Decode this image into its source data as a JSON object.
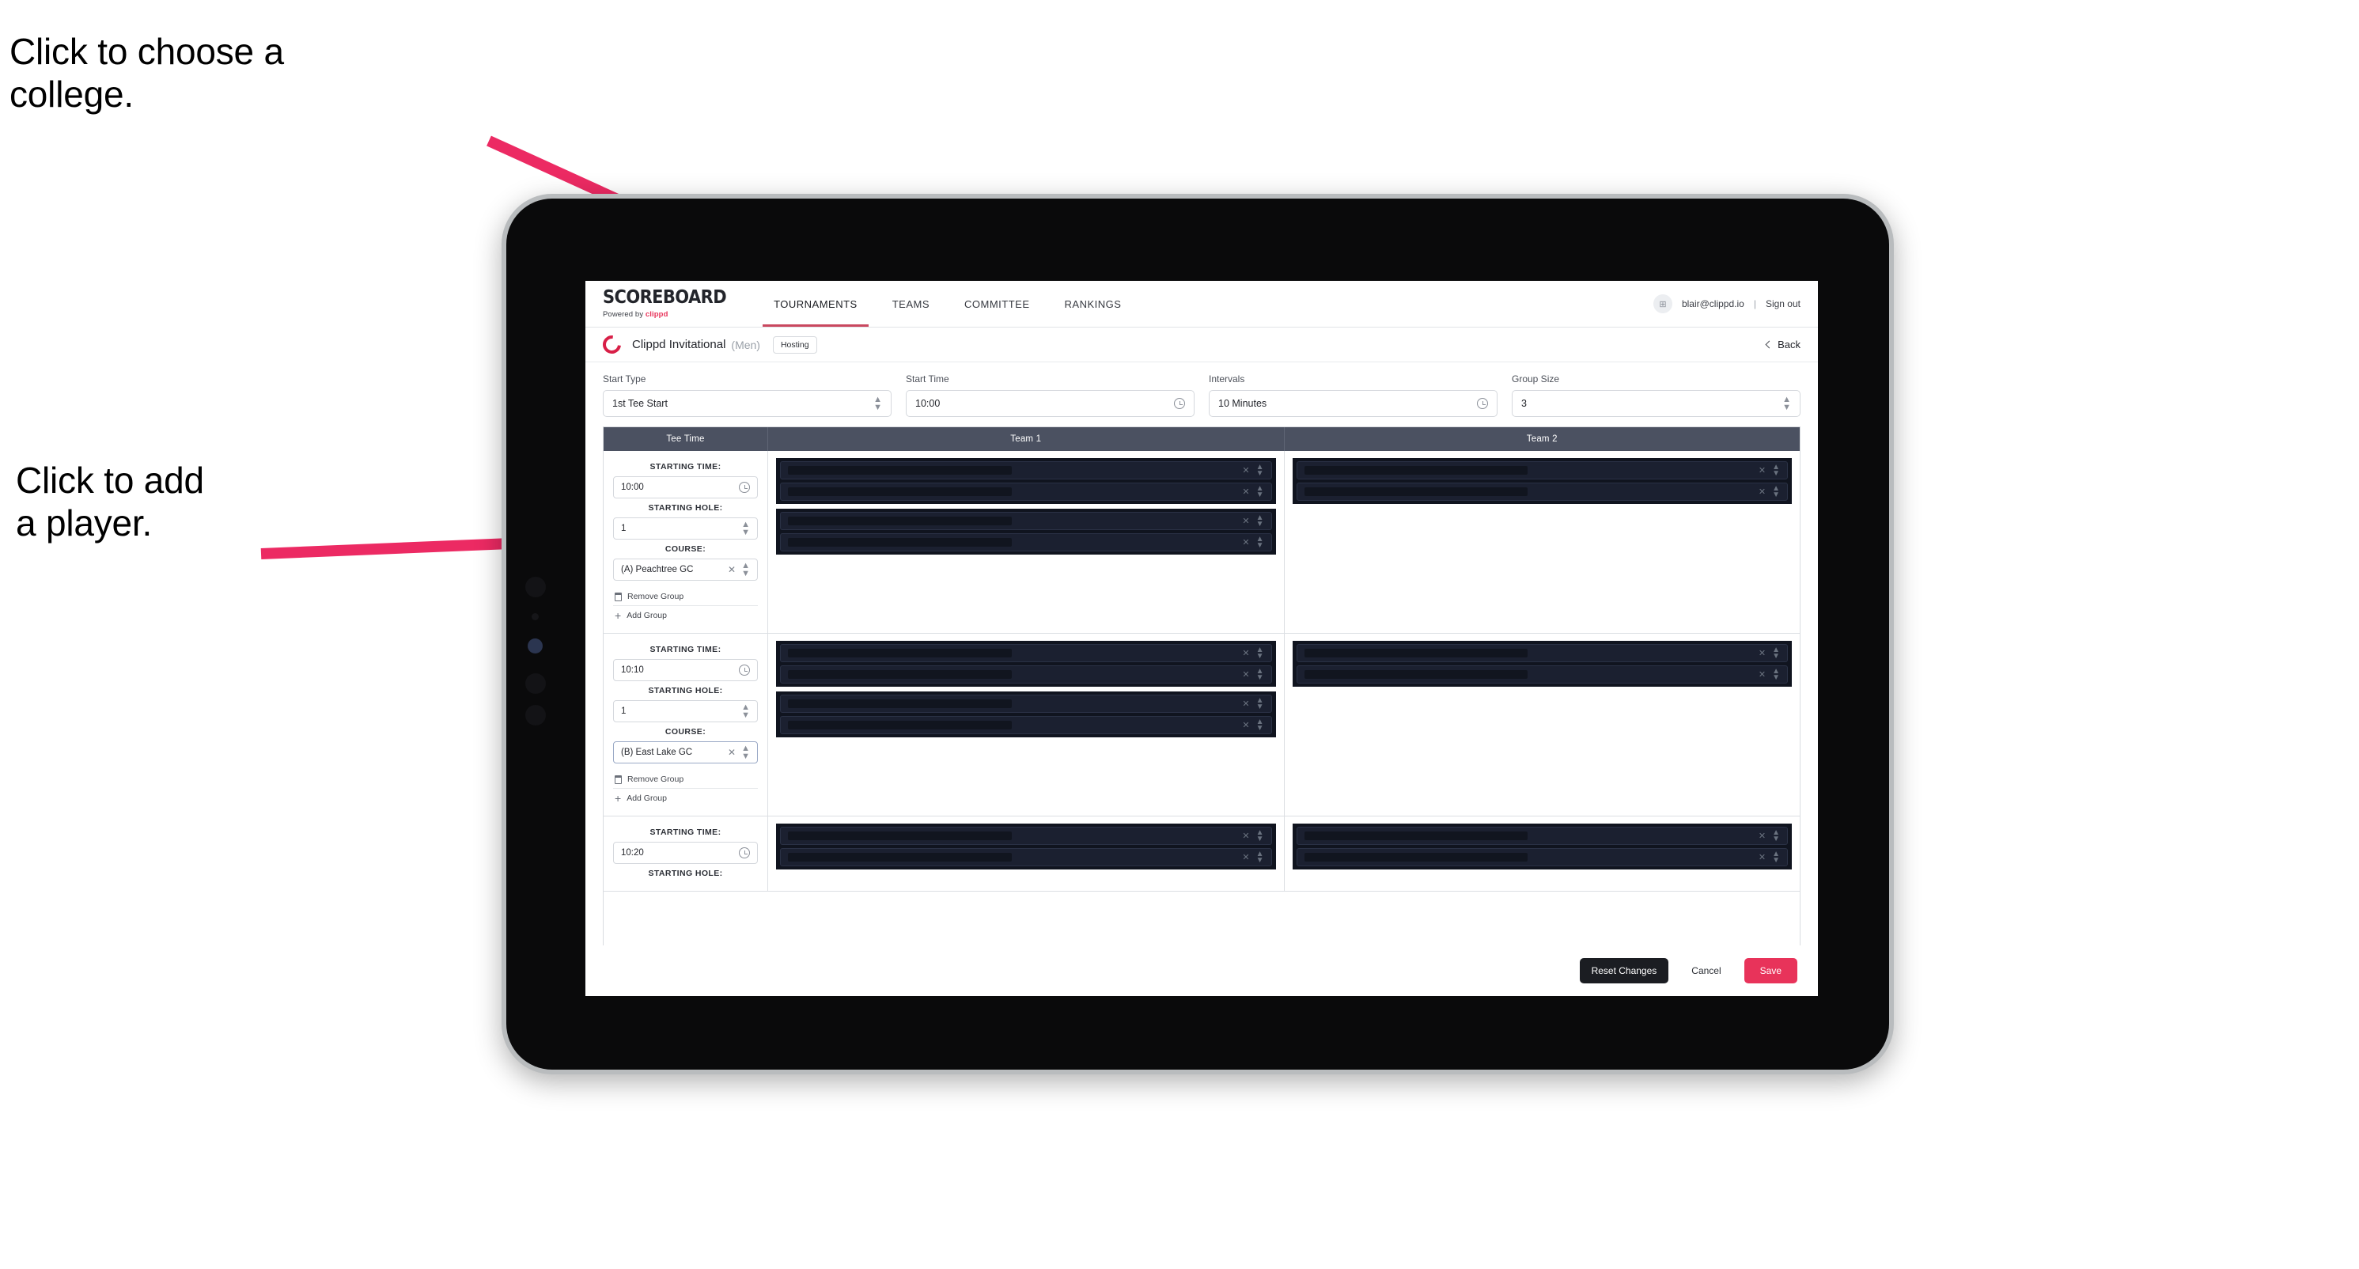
{
  "annotations": [
    {
      "id": "college",
      "text": "Click to choose a\ncollege."
    },
    {
      "id": "player",
      "text": "Click to add\na player."
    }
  ],
  "app": {
    "logo": {
      "main": "SCOREBOARD",
      "sub_prefix": "Powered by ",
      "sub_brand": "clippd"
    },
    "nav": [
      {
        "label": "TOURNAMENTS",
        "active": true
      },
      {
        "label": "TEAMS",
        "active": false
      },
      {
        "label": "COMMITTEE",
        "active": false
      },
      {
        "label": "RANKINGS",
        "active": false
      }
    ],
    "account": {
      "avatar_glyph": "⊞",
      "email": "blair@clippd.io",
      "separator": "|",
      "signout": "Sign out"
    },
    "tournament": {
      "name": "Clippd Invitational",
      "gender": "(Men)",
      "badge": "Hosting",
      "back": "Back"
    },
    "filters": [
      {
        "label": "Start Type",
        "value": "1st Tee Start",
        "control": "stepper"
      },
      {
        "label": "Start Time",
        "value": "10:00",
        "control": "clock"
      },
      {
        "label": "Intervals",
        "value": "10 Minutes",
        "control": "clock"
      },
      {
        "label": "Group Size",
        "value": "3",
        "control": "stepper"
      }
    ],
    "table": {
      "columns": [
        "Tee Time",
        "Team 1",
        "Team 2"
      ],
      "labels": {
        "starting_time": "STARTING TIME:",
        "starting_hole": "STARTING HOLE:",
        "course": "COURSE:",
        "remove_group": "Remove Group",
        "add_group": "Add Group"
      },
      "rows": [
        {
          "starting_time": "10:00",
          "starting_hole": "1",
          "course": "(A) Peachtree GC",
          "course_focused": false,
          "team1_groups": [
            {
              "players": [
                "",
                ""
              ]
            },
            {
              "players": [
                "",
                ""
              ]
            }
          ],
          "team2_groups": [
            {
              "players": [
                "",
                ""
              ]
            }
          ]
        },
        {
          "starting_time": "10:10",
          "starting_hole": "1",
          "course": "(B) East Lake GC",
          "course_focused": true,
          "team1_groups": [
            {
              "players": [
                "",
                ""
              ]
            },
            {
              "players": [
                "",
                ""
              ]
            }
          ],
          "team2_groups": [
            {
              "players": [
                "",
                ""
              ]
            }
          ]
        },
        {
          "starting_time": "10:20",
          "starting_hole": "",
          "course": "",
          "course_focused": false,
          "team1_groups": [
            {
              "players": [
                "",
                ""
              ]
            }
          ],
          "team2_groups": [
            {
              "players": [
                "",
                ""
              ]
            }
          ]
        }
      ]
    },
    "footer": {
      "reset": "Reset Changes",
      "cancel": "Cancel",
      "save": "Save"
    }
  },
  "colors": {
    "accent_pink": "#e8335a",
    "brand_red": "#d81f47",
    "table_header": "#4b5161",
    "player_panel": "#10141f",
    "annotation_arrow": "#ec2a63"
  }
}
